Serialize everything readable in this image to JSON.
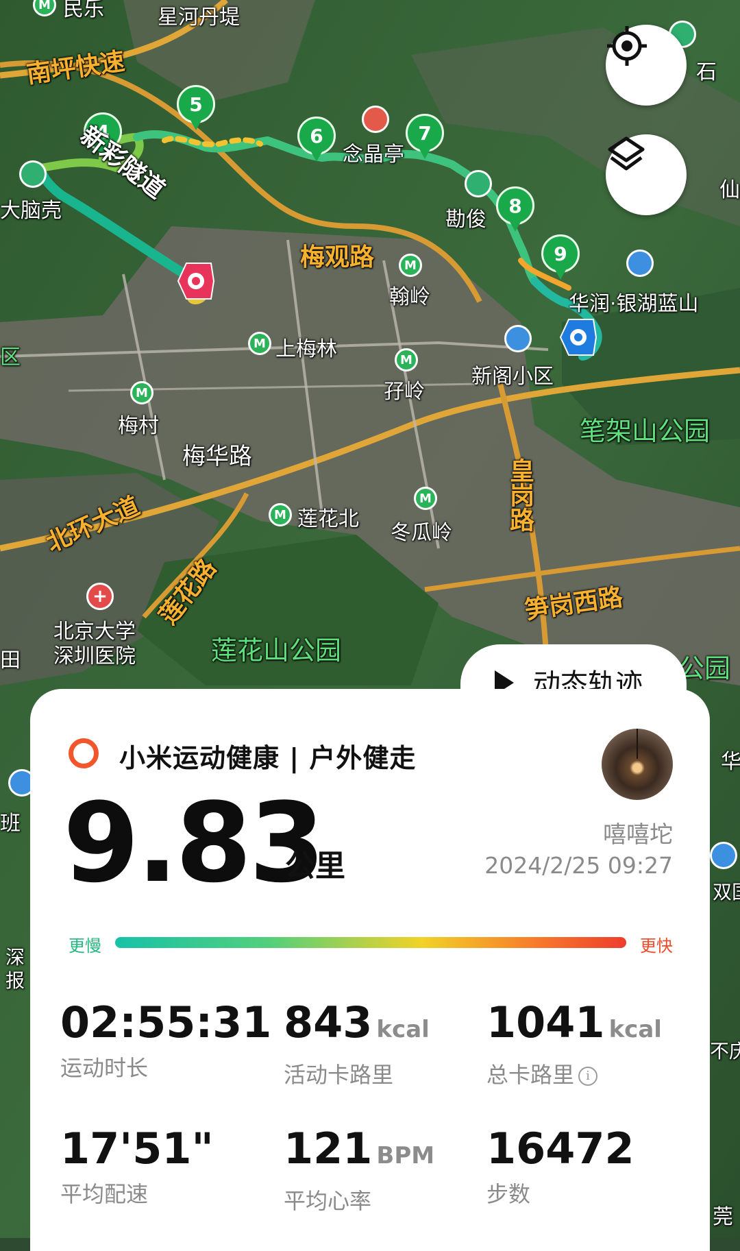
{
  "map": {
    "road_labels": [
      "南坪快速",
      "新彩隧道",
      "梅观路",
      "北环大道",
      "莲花路",
      "皇岗路",
      "笋岗西路"
    ],
    "place_labels": [
      "民乐",
      "星河丹堤",
      "大脑壳",
      "念晶亭",
      "勘俊",
      "翰岭",
      "华润·银湖蓝山",
      "上梅林",
      "孖岭",
      "新阁小区",
      "梅村",
      "梅华路",
      "莲花北",
      "冬瓜岭",
      "北京大学\n深圳医院",
      "石",
      "仙",
      "区",
      "田",
      "班",
      "深\n报",
      "莞",
      "华",
      "双国",
      "不庆"
    ],
    "park_labels": [
      "笔架山公园",
      "莲花山公园",
      "公园"
    ],
    "km_markers": [
      "4",
      "5",
      "6",
      "7",
      "8",
      "9"
    ],
    "metro_icon_glyph": "M",
    "icons": {
      "locate": "crosshair-icon",
      "layers": "layers-icon",
      "start": "start-marker-icon",
      "end": "end-marker-icon",
      "mountain": "mountain-poi-icon",
      "building": "building-poi-icon",
      "pavilion": "pavilion-poi-icon",
      "hospital": "hospital-poi-icon",
      "metro": "metro-station-icon"
    },
    "hospital_glyph": "+"
  },
  "replay": {
    "label": "动态轨迹"
  },
  "card": {
    "app_title": "小米运动健康 | 户外健走",
    "distance": "9.83",
    "distance_unit": "公里",
    "user_name": "嘻嘻坨",
    "datetime": "2024/2/25 09:27",
    "speed_legend": {
      "slow": "更慢",
      "fast": "更快"
    },
    "stats": [
      {
        "value": "02:55:31",
        "unit": "",
        "label": "运动时长"
      },
      {
        "value": "843",
        "unit": "kcal",
        "label": "活动卡路里"
      },
      {
        "value": "1041",
        "unit": "kcal",
        "label": "总卡路里"
      },
      {
        "value": "17'51\"",
        "unit": "",
        "label": "平均配速"
      },
      {
        "value": "121",
        "unit": "BPM",
        "label": "平均心率"
      },
      {
        "value": "16472",
        "unit": "",
        "label": "步数"
      }
    ],
    "info_glyph": "i"
  },
  "colors": {
    "accent_ring": "#f2562c",
    "slow": "#27b87f",
    "fast": "#ef4b2a",
    "km_marker": "#19a94a",
    "end_marker": "#e8345a",
    "start_marker": "#1e7be0"
  }
}
